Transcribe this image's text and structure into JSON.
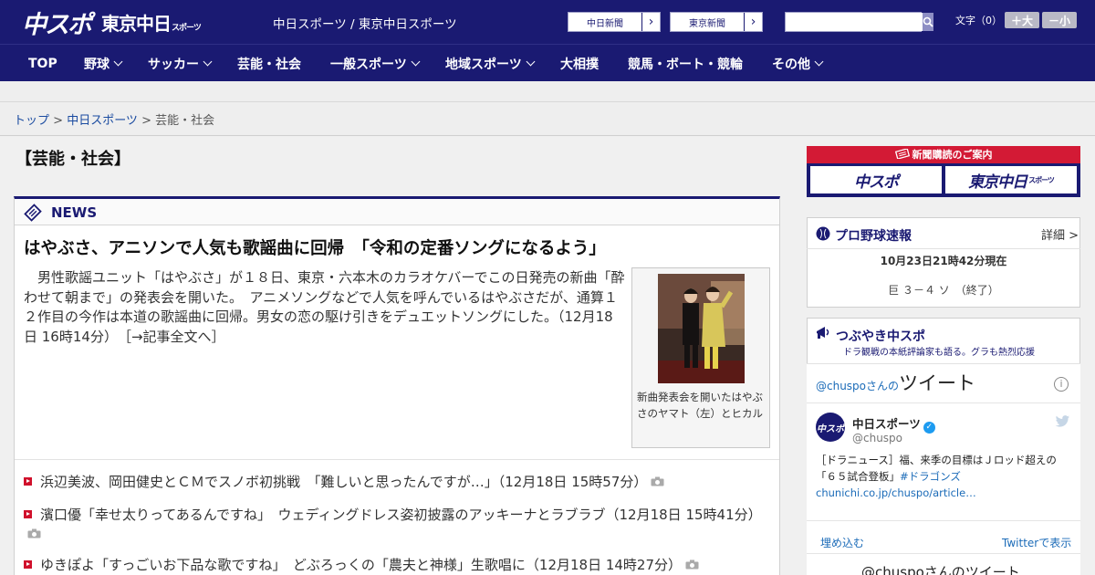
{
  "header": {
    "logo_main": "中スポ",
    "logo_sub": "東京中日",
    "logo_sub_small": "スポーツ",
    "site_title": "中日スポーツ / 東京中日スポーツ",
    "paper_links": [
      "中日新聞",
      "東京新聞"
    ],
    "paper_link_arrow": "›",
    "search_placeholder": "",
    "fontsize_label": "文字（0）",
    "fontsize_large": "＋大",
    "fontsize_small": "－小"
  },
  "nav": {
    "items": [
      {
        "label": "TOP",
        "dropdown": false
      },
      {
        "label": "野球",
        "dropdown": true
      },
      {
        "label": "サッカー",
        "dropdown": true
      },
      {
        "label": "芸能・社会",
        "dropdown": false
      },
      {
        "label": "一般スポーツ",
        "dropdown": true
      },
      {
        "label": "地域スポーツ",
        "dropdown": true
      },
      {
        "label": "大相撲",
        "dropdown": false
      },
      {
        "label": "競馬・ボート・競輪",
        "dropdown": false
      },
      {
        "label": "その他",
        "dropdown": true
      }
    ]
  },
  "breadcrumb": {
    "home": "トップ",
    "sep": " > ",
    "section": "中日スポーツ",
    "current": "芸能・社会"
  },
  "page": {
    "title": "【芸能・社会】"
  },
  "news": {
    "label": "NEWS",
    "headline": "はやぶさ、アニソンで人気も歌謡曲に回帰　「令和の定番ソングになるよう」",
    "lead": "　男性歌謡ユニット「はやぶさ」が１８日、東京・六本木のカラオケバーでこの日発売の新曲「酔わせて朝まで」の発表会を開いた。　アニメソングなどで人気を呼んでいるはやぶさだが、通算１２作目の今作は本道の歌謡曲に回帰。男女の恋の駆け引きをデュエットソングにした。（12月18日 16時14分）　",
    "more_link": "［→記事全文へ］",
    "photo_caption": "新曲発表会を開いたはやぶさのヤマト（左）とヒカル",
    "items": [
      {
        "text": "浜辺美波、岡田健史とＣＭでスノボ初挑戦　「難しいと思ったんですが…」（12月18日 15時57分）",
        "camera": true
      },
      {
        "text": "濱口優「幸せ太りってあるんですね」　ウェディングドレス姿初披露のアッキーナとラブラブ（12月18日 15時41分）",
        "camera": true
      },
      {
        "text": "ゆきぽよ「すっごいお下品な歌ですね」　どぶろっくの「農夫と神様」生歌唱に（12月18日 14時27分）",
        "camera": true
      }
    ]
  },
  "sidebar": {
    "subscribe_title": "新聞購読のご案内",
    "subscribe_buttons": [
      {
        "label": "中スポ",
        "small": ""
      },
      {
        "label": "東京中日",
        "small": "スポーツ"
      }
    ],
    "baseball": {
      "title": "プロ野球速報",
      "detail": "詳細 >",
      "time": "10月23日21時42分現在",
      "score": "巨 ３－４ ソ　（終了）"
    },
    "twitter": {
      "title": "つぶやき中スポ",
      "subtitle": "ドラ観戦の本紙評論家も語る。グラも熱烈応援",
      "header_handle": "@chuspoさんの",
      "header_big": "ツイート",
      "info": "i",
      "name": "中日スポーツ",
      "handle": "@chuspo",
      "avatar_text": "中スポ",
      "tweet_plain": "［ドラニュース］福、来季の目標はＪロッド超えの「６５試合登板」",
      "tweet_hashtag": "#ドラゴンズ",
      "tweet_link": "chunichi.co.jp/chuspo/article…",
      "embed": "埋め込む",
      "view_on_twitter": "Twitterで表示",
      "footer": "@chuspoさんのツイート"
    }
  },
  "colors": {
    "navy": "#1a1a72",
    "red": "#d31a35",
    "link": "#1b6bb8"
  }
}
